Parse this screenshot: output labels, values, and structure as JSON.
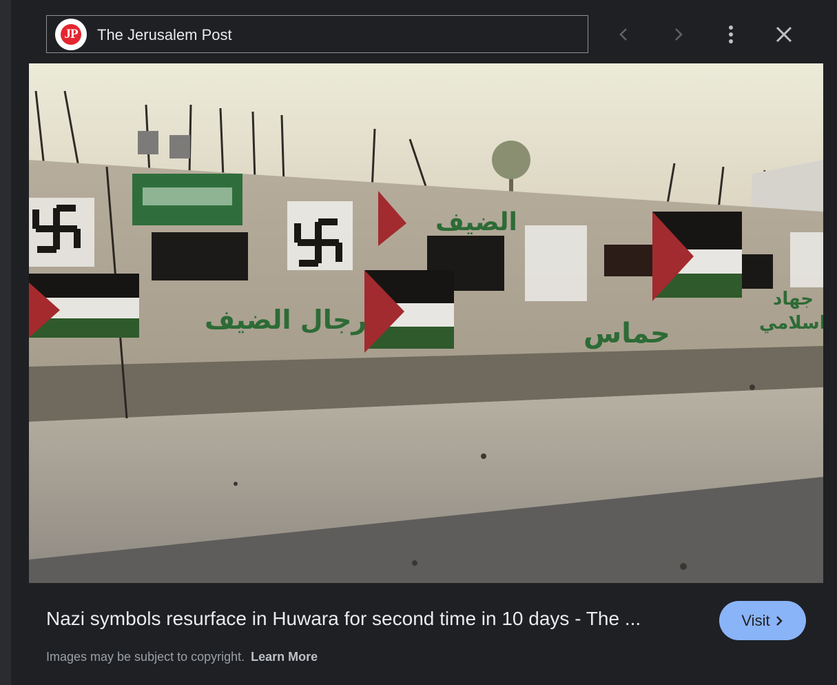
{
  "source": {
    "logo_text": "JP",
    "name": "The Jerusalem Post"
  },
  "controls": {
    "prev_icon": "chevron-left-icon",
    "next_icon": "chevron-right-icon",
    "more_icon": "more-vert-icon",
    "close_icon": "close-icon"
  },
  "image": {
    "graffiti_texts": [
      "الضيف",
      "رجال الضيف",
      "حماس",
      "جهاد",
      "اسلامي"
    ]
  },
  "caption": "Nazi symbols resurface in Huwara for second time in 10 days - The ...",
  "visit_button": {
    "label": "Visit",
    "icon": "chevron-right-icon"
  },
  "footer": {
    "copyright_text": "Images may be subject to copyright.",
    "learn_more": "Learn More"
  },
  "colors": {
    "background": "#1f2023",
    "accent": "#8ab4f8",
    "logo_red": "#e3262f"
  }
}
